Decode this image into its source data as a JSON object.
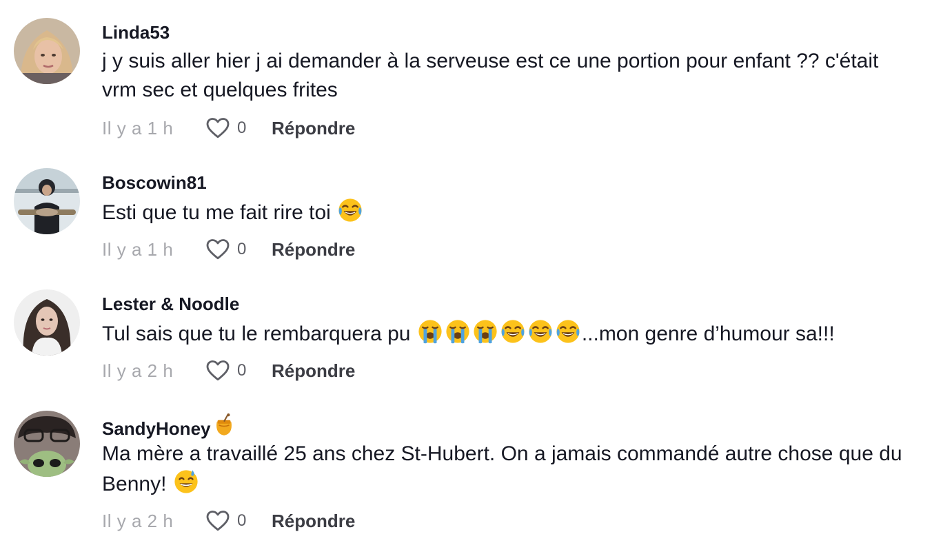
{
  "comments": [
    {
      "username": "Linda53",
      "text": "j y suis aller hier j ai demander à la serveuse est ce une portion pour enfant ?? c'était vrm sec et quelques frites",
      "time": "Il y a 1 h",
      "likes": "0",
      "reply_label": "Répondre"
    },
    {
      "username": "Boscowin81",
      "text": "Esti que tu me fait rire toi",
      "time": "Il y a 1 h",
      "likes": "0",
      "reply_label": "Répondre"
    },
    {
      "username": "Lester & Noodle",
      "text_before": "Tul sais que tu le rembarquera pu",
      "text_after": "...mon genre d’humour sa!!!",
      "time": "Il y a 2 h",
      "likes": "0",
      "reply_label": "Répondre"
    },
    {
      "username": "SandyHoney",
      "text": "Ma mère a travaillé 25 ans chez St-Hubert. On a jamais commandé autre chose que du Benny!",
      "time": "Il y a 2 h",
      "likes": "0",
      "reply_label": "Répondre"
    }
  ],
  "icons": {
    "like": "heart-outline-icon",
    "laughing_emoji": "face-with-tears-of-joy",
    "crying_emoji": "loudly-crying-face",
    "sweat_smile_emoji": "grinning-face-with-sweat",
    "honey_emoji": "honey-pot"
  },
  "colors": {
    "username": "#161823",
    "timestamp": "#a7a8ad",
    "reply": "#3c3d44"
  }
}
